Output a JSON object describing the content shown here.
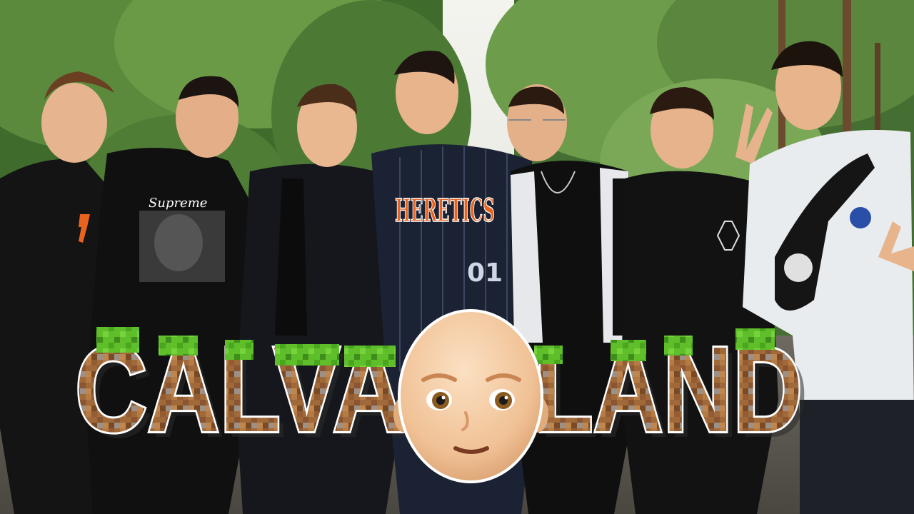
{
  "thumbnail": {
    "title_left": "CALVA",
    "title_right": "LAND",
    "title_center": "bald-head-emoji",
    "jersey_text": "HERETICS",
    "jersey_number": "01",
    "shirt_text": "Supreme",
    "colors": {
      "grass_green": "#5fbf2a",
      "dirt_brown": "#a0693a",
      "dirt_dark": "#7a4a24",
      "jersey_orange": "#e8631f",
      "jersey_navy": "#1b2233",
      "emoji_skin": "#f2c9a0",
      "hoodie_white": "#e9ecef",
      "forest_green": "#3d6b2c"
    }
  }
}
